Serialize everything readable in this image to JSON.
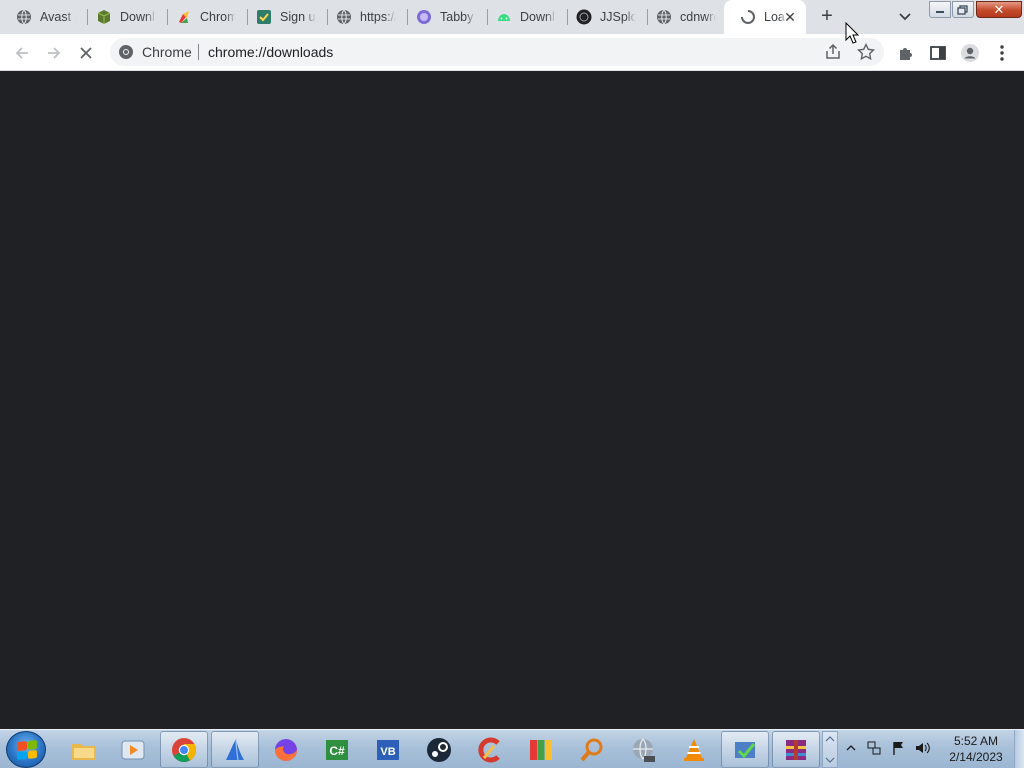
{
  "tabs": [
    {
      "title": "Avast | ",
      "icon": "globe-icon"
    },
    {
      "title": "Downlo",
      "icon": "box-icon"
    },
    {
      "title": "Chrome",
      "icon": "chrome-paint-icon"
    },
    {
      "title": "Sign up",
      "icon": "signup-icon"
    },
    {
      "title": "https://",
      "icon": "globe-icon"
    },
    {
      "title": "Tabby C",
      "icon": "tabby-icon"
    },
    {
      "title": "Downlo",
      "icon": "android-icon"
    },
    {
      "title": "JJSploit",
      "icon": "jjsploit-icon"
    },
    {
      "title": "cdnwro",
      "icon": "globe-icon"
    },
    {
      "title": "Loa",
      "icon": "loading-spinner-icon",
      "active": true
    }
  ],
  "toolbar": {
    "site_label": "Chrome",
    "url": "chrome://downloads"
  },
  "colors": {
    "content_background": "#202124",
    "tabstrip_background": "#dee1e6",
    "omnibox_background": "#f1f3f4"
  },
  "taskbar": {
    "apps": [
      {
        "name": "explorer-icon"
      },
      {
        "name": "media-player-icon"
      },
      {
        "name": "chrome-icon",
        "running": true
      },
      {
        "name": "shark-app-icon",
        "running": true
      },
      {
        "name": "firefox-icon"
      },
      {
        "name": "csharp-icon"
      },
      {
        "name": "vb-icon"
      },
      {
        "name": "steam-icon"
      },
      {
        "name": "ccleaner-icon"
      },
      {
        "name": "winrar-color-icon"
      },
      {
        "name": "search-tool-icon"
      },
      {
        "name": "google-earth-pro-icon"
      },
      {
        "name": "vlc-icon"
      },
      {
        "name": "installer-icon",
        "running": true
      },
      {
        "name": "winrar-icon",
        "running": true
      }
    ],
    "clock": {
      "time": "5:52 AM",
      "date": "2/14/2023"
    }
  }
}
